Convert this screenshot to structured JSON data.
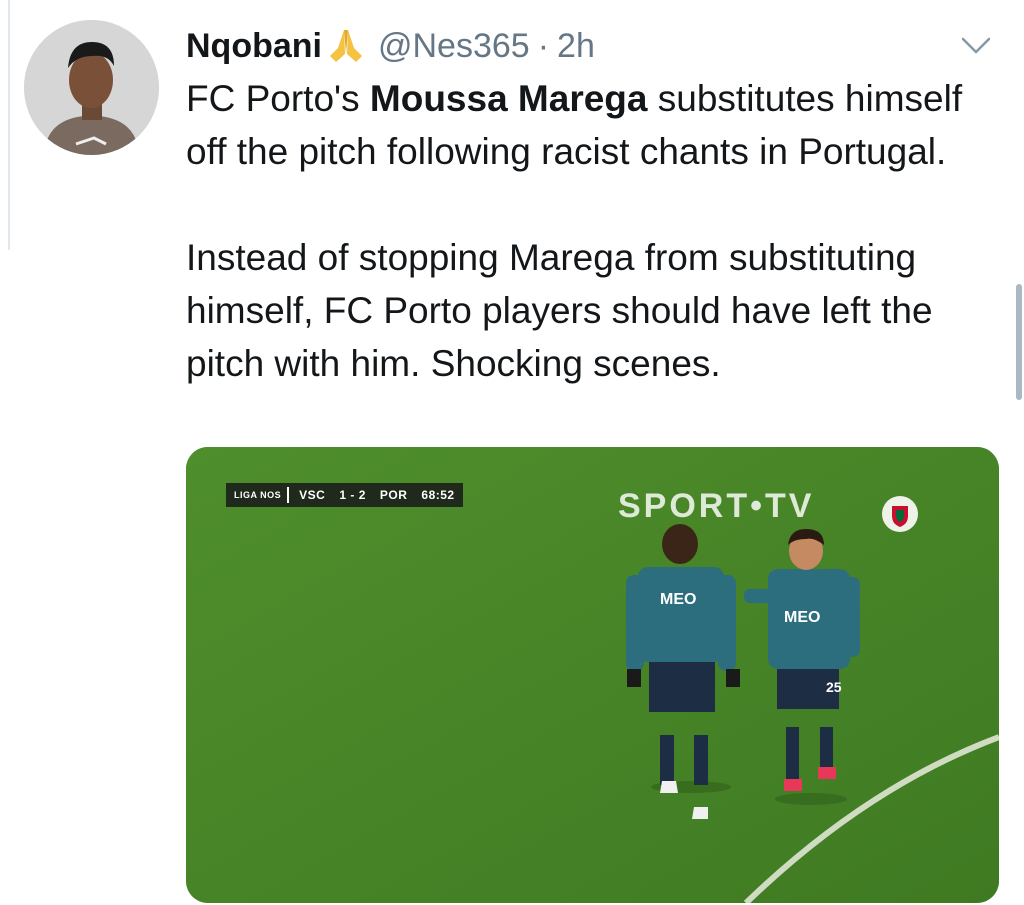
{
  "tweet": {
    "display_name": "Nqobani",
    "emoji_icon": "folded-hands-emoji",
    "handle": "@Nes365",
    "separator": "·",
    "time": "2h",
    "text": {
      "p1_a": "FC Porto's ",
      "p1_bold": "Moussa Marega",
      "p1_b": " substitutes himself off the pitch following racist chants in Portugal.",
      "p2": "Instead of stopping Marega from substituting himself, FC Porto players should have left the pitch with him. Shocking scenes."
    },
    "menu_icon": "chevron-down-icon"
  },
  "media": {
    "scorebug": {
      "league": "LIGA NOS",
      "home": "VSC",
      "score": "1 - 2",
      "away": "POR",
      "clock": "68:52"
    },
    "broadcaster": "SPORT•TV",
    "shirt_sponsor_1": "MEO",
    "shirt_sponsor_2": "MEO",
    "shirt_number_2": "25"
  },
  "colors": {
    "text": "#14171a",
    "muted": "#657786",
    "pitch": "#4f8a2c",
    "kit": "#1f3b57"
  }
}
